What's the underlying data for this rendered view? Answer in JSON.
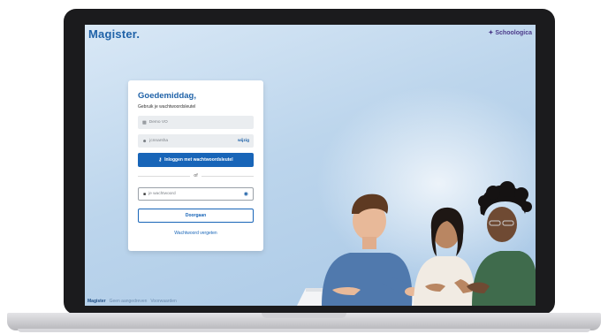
{
  "header": {
    "logo": "Magister.",
    "partner": "Schoologica",
    "partner_icon": "sparkle-icon"
  },
  "login": {
    "greeting": "Goedemiddag,",
    "subtitle": "Gebruik je wachtwoordsleutel",
    "school_value": "Demo VO",
    "school_icon": "school-icon",
    "username_value": "jcnnarsha",
    "username_icon": "user-icon",
    "username_action": "wijzig",
    "passkey_button": "Inloggen met wachtwoordsleutel",
    "passkey_icon": "key-icon",
    "divider": "of",
    "password_placeholder": "je wachtwoord",
    "password_icon": "lock-icon",
    "eye_icon": "eye-icon",
    "continue_button": "Doorgaan",
    "forgot_link": "Wachtwoord vergeten"
  },
  "footer": {
    "brand": "Magister",
    "link_1": "Geen aangedreven",
    "link_2": "Voorwaarden"
  },
  "colors": {
    "brand": "#1f62a8",
    "primary_button": "#1865b8",
    "partner": "#4b3a8a"
  }
}
